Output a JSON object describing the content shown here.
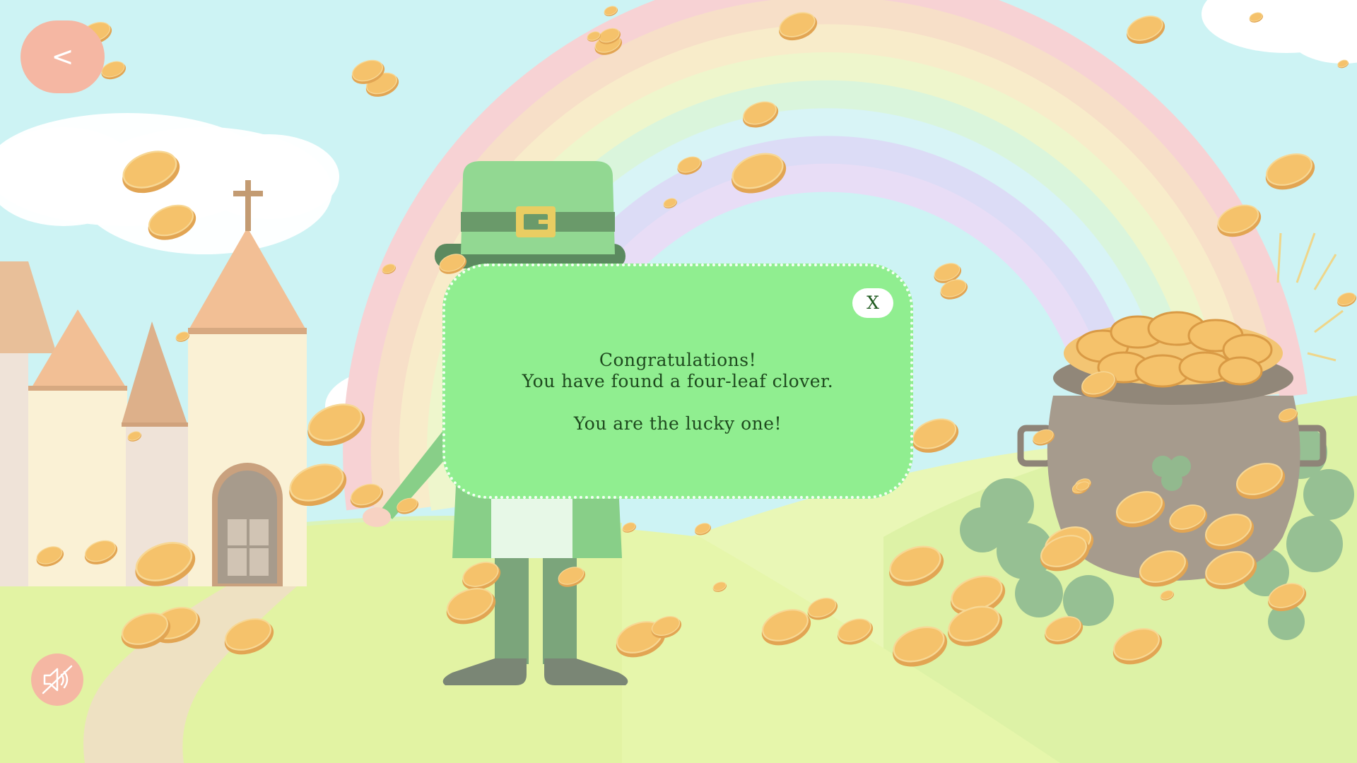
{
  "navigation": {
    "back_label": "<"
  },
  "modal": {
    "close_label": "X",
    "line1": "Congratulations!",
    "line2": "You have found a four-leaf clover.",
    "line3": "You are the lucky one!"
  },
  "audio": {
    "state": "muted",
    "icon": "speaker-muted-icon"
  },
  "colors": {
    "sky": "#cdf3f4",
    "modal_fill": "#90ee90",
    "button": "#f5b7a3",
    "coin": "#f5c26b",
    "hat": "#92d892",
    "pot": "#a69b8d"
  }
}
